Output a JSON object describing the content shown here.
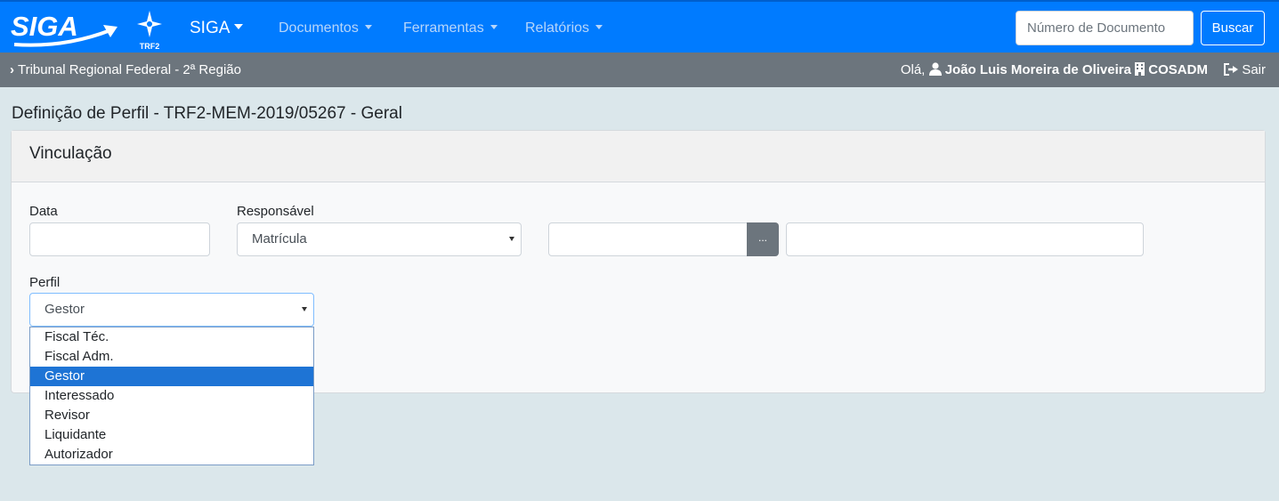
{
  "navbar": {
    "logo_text": "SIGA",
    "logo_sub": "TRF2",
    "brand": "SIGA",
    "menus": [
      "Documentos",
      "Ferramentas",
      "Relatórios"
    ],
    "search_placeholder": "Número de Documento",
    "search_button": "Buscar",
    "colors": {
      "bar": "#007bff",
      "muted_link": "#b7d6fa"
    }
  },
  "subbar": {
    "breadcrumb": "Tribunal Regional Federal - 2ª Região",
    "greeting": "Olá,",
    "user": "João Luis Moreira de Oliveira",
    "unit": "COSADM",
    "logout": "Sair"
  },
  "page": {
    "title": "Definição de Perfil - TRF2-MEM-2019/05267 - Geral"
  },
  "card": {
    "header": "Vinculação",
    "data_label": "Data",
    "data_value": "",
    "responsavel_label": "Responsável",
    "responsavel_selected": "Matrícula",
    "matricula_value": "",
    "dots_label": "...",
    "nome_value": "",
    "perfil_label": "Perfil",
    "perfil_selected": "Gestor",
    "perfil_options": [
      "Fiscal Téc.",
      "Fiscal Adm.",
      "Gestor",
      "Interessado",
      "Revisor",
      "Liquidante",
      "Autorizador"
    ],
    "perfil_highlighted": "Gestor"
  }
}
